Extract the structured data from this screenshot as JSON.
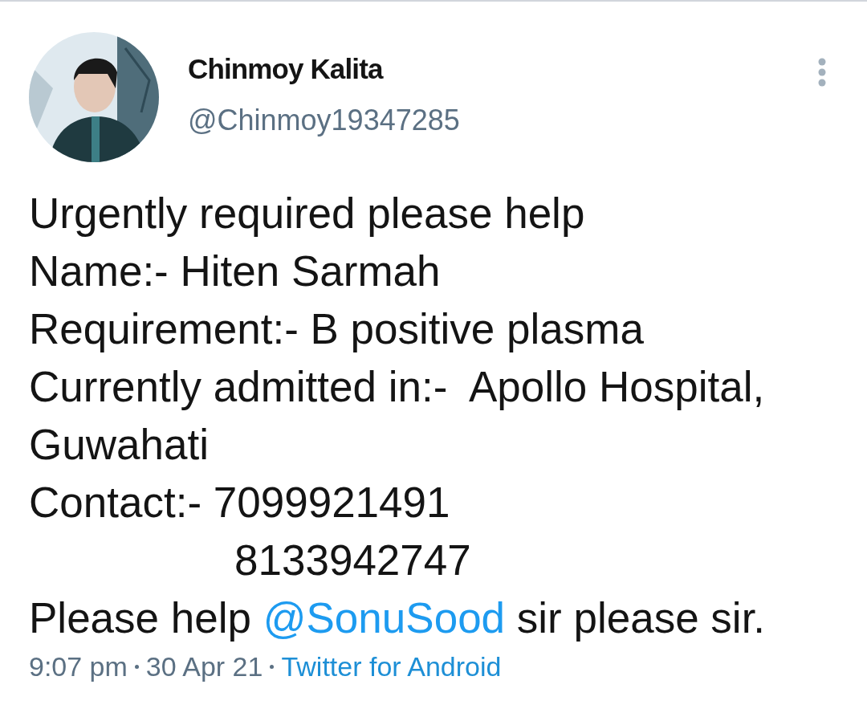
{
  "author": {
    "name": "Chinmoy Kalita",
    "handle": "@Chinmoy19347285"
  },
  "lines": [
    {
      "kind": "text",
      "text": "Urgently required please help"
    },
    {
      "kind": "text",
      "text": "Name:- Hiten Sarmah"
    },
    {
      "kind": "text",
      "text": "Requirement:- B positive plasma"
    },
    {
      "kind": "text",
      "text": "Currently admitted in:-  Apollo Hospital, Guwahati"
    },
    {
      "kind": "text",
      "text": "Contact:- 7099921491"
    },
    {
      "kind": "indented",
      "text": "8133942747"
    },
    {
      "kind": "mention",
      "before": "Please help ",
      "mention": "@SonuSood",
      "after": " sir please sir."
    }
  ],
  "meta": {
    "time": "9:07 pm",
    "date": "30 Apr 21",
    "source": "Twitter for Android"
  }
}
